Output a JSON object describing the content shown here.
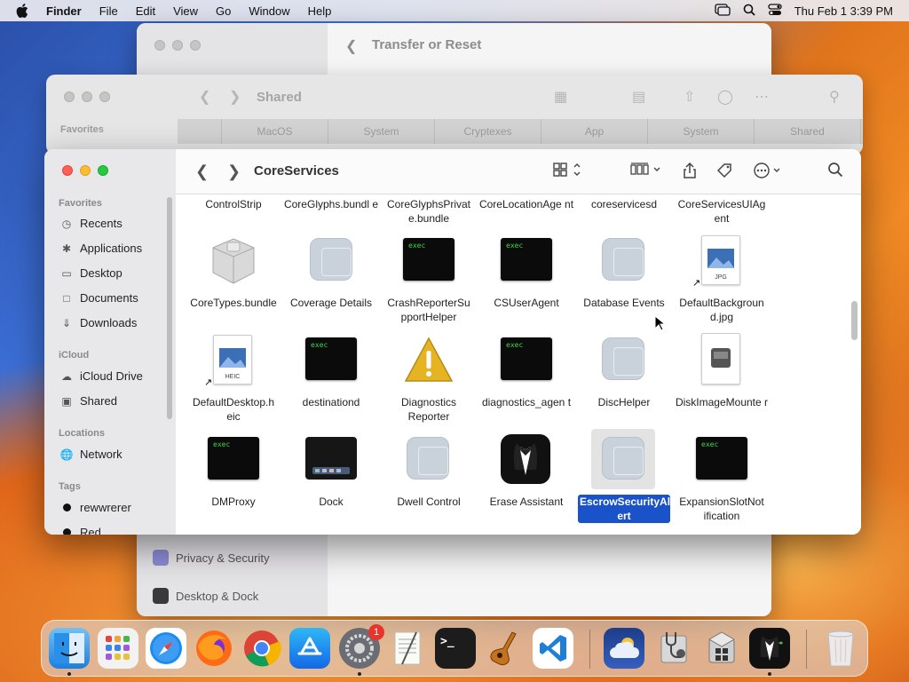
{
  "menubar": {
    "app": "Finder",
    "items": [
      "File",
      "Edit",
      "View",
      "Go",
      "Window",
      "Help"
    ],
    "datetime": "Thu Feb 1  3:39 PM"
  },
  "settings_window": {
    "title": "Transfer or Reset",
    "sidebar_items": [
      "Privacy & Security",
      "Desktop & Dock"
    ]
  },
  "shared_window": {
    "title": "Shared",
    "favorites_label": "Favorites",
    "columns": [
      "MacOS",
      "System",
      "Cryptexes",
      "App",
      "System",
      "Shared"
    ]
  },
  "finder": {
    "title": "CoreServices",
    "sidebar": {
      "favorites_header": "Favorites",
      "favorites": [
        "Recents",
        "Applications",
        "Desktop",
        "Documents",
        "Downloads"
      ],
      "icloud_header": "iCloud",
      "icloud": [
        "iCloud Drive",
        "Shared"
      ],
      "locations_header": "Locations",
      "locations": [
        "Network"
      ],
      "tags_header": "Tags",
      "tags": [
        "rewwrerer",
        "Red"
      ]
    },
    "row0": [
      "ControlStrip",
      "CoreGlyphs.bundl e",
      "CoreGlyphsPrivat e.bundle",
      "CoreLocationAge nt",
      "coreservicesd",
      "CoreServicesUIAg ent"
    ],
    "items": [
      {
        "label": "CoreTypes.bundle",
        "kind": "bundle"
      },
      {
        "label": "Coverage Details",
        "kind": "app"
      },
      {
        "label": "CrashReporterSu pportHelper",
        "kind": "exec"
      },
      {
        "label": "CSUserAgent",
        "kind": "exec"
      },
      {
        "label": "Database Events",
        "kind": "app"
      },
      {
        "label": "DefaultBackgroun d.jpg",
        "kind": "jpg",
        "badge": "JPG"
      },
      {
        "label": "DefaultDesktop.h eic",
        "kind": "heic",
        "badge": "HEIC"
      },
      {
        "label": "destinationd",
        "kind": "exec"
      },
      {
        "label": "Diagnostics Reporter",
        "kind": "warning"
      },
      {
        "label": "diagnostics_agen t",
        "kind": "exec"
      },
      {
        "label": "DiscHelper",
        "kind": "app"
      },
      {
        "label": "DiskImageMounte r",
        "kind": "disk"
      },
      {
        "label": "DMProxy",
        "kind": "exec"
      },
      {
        "label": "Dock",
        "kind": "dock"
      },
      {
        "label": "Dwell Control",
        "kind": "app"
      },
      {
        "label": "Erase Assistant",
        "kind": "tux"
      },
      {
        "label": "EscrowSecurityAl ert",
        "kind": "app",
        "selected": true
      },
      {
        "label": "ExpansionSlotNot ification",
        "kind": "exec"
      }
    ],
    "exec_text": "exec"
  },
  "dock": {
    "settings_badge": "1"
  }
}
